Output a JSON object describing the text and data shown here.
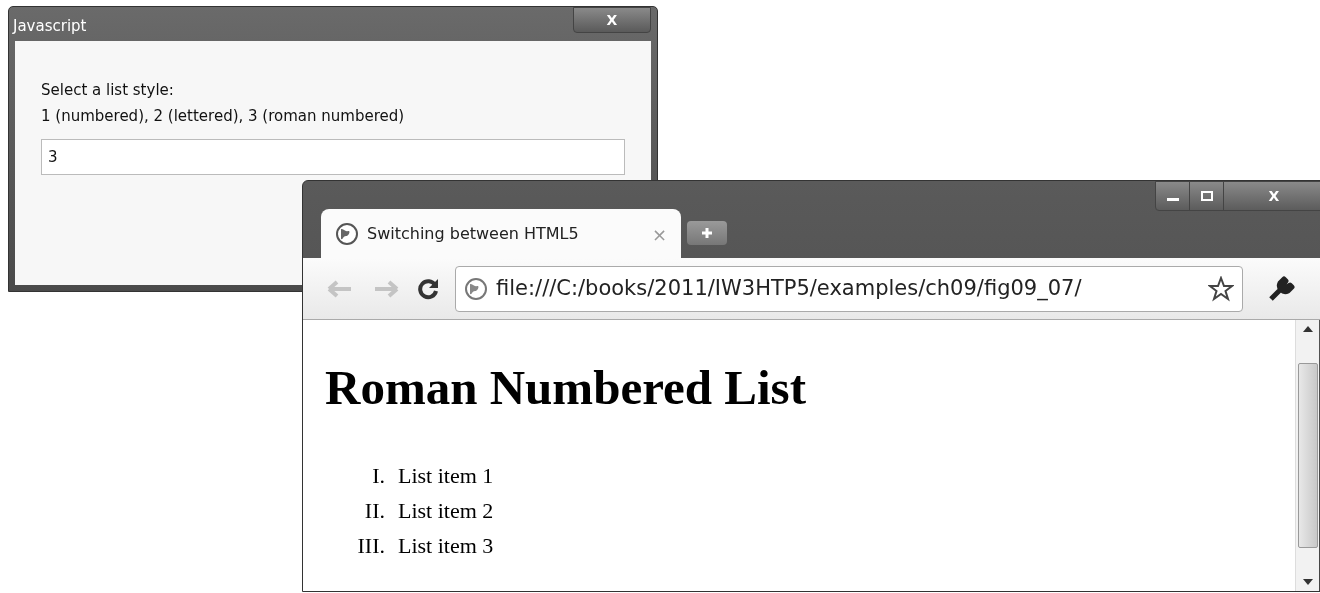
{
  "dialog": {
    "title": "Javascript",
    "close": "X",
    "message_lines": [
      "Select a list style:",
      "1 (numbered), 2 (lettered), 3 (roman numbered)"
    ],
    "input_value": "3"
  },
  "browser": {
    "close": "X",
    "tabs": [
      {
        "title": "Switching between HTML5",
        "close": "×",
        "selected": true
      }
    ],
    "address": "file:///C:/books/2011/IW3HTP5/examples/ch09/fig09_07/",
    "page": {
      "heading": "Roman Numbered List",
      "list": [
        {
          "marker": "I.",
          "text": "List item 1"
        },
        {
          "marker": "II.",
          "text": "List item 2"
        },
        {
          "marker": "III.",
          "text": "List item 3"
        }
      ]
    }
  }
}
